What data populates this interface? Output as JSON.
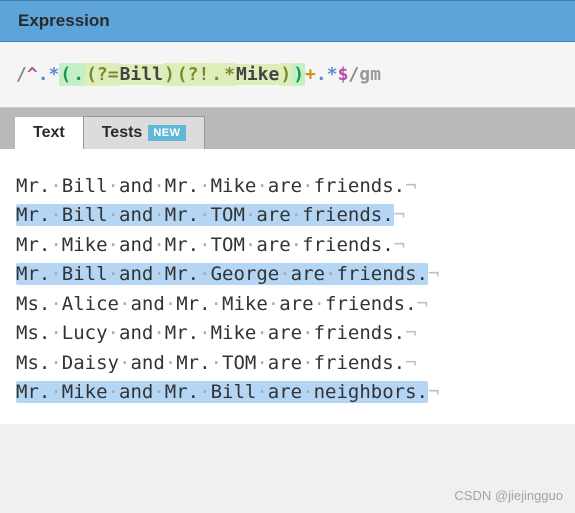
{
  "header": {
    "title": "Expression"
  },
  "regex": {
    "open_delim": "/",
    "anchor_start": "^",
    "dot1": ".",
    "star1": "*",
    "grp_open": "(",
    "dot2": ".",
    "look1_open": "(?=",
    "look1_text": "Bill",
    "look1_close": ")",
    "look2_open": "(?!",
    "look2_dot": ".",
    "look2_star": "*",
    "look2_text": "Mike",
    "look2_close": ")",
    "grp_close": ")",
    "plus": "+",
    "dot3": ".",
    "star3": "*",
    "anchor_end": "$",
    "close_delim": "/",
    "flags": "gm"
  },
  "tabs": {
    "text": "Text",
    "tests": "Tests",
    "badge": "NEW"
  },
  "lines": [
    {
      "w": [
        "Mr.",
        "Bill",
        "and",
        "Mr.",
        "Mike",
        "are",
        "friends."
      ],
      "match": false
    },
    {
      "w": [
        "Mr.",
        "Bill",
        "and",
        "Mr.",
        "TOM",
        "are",
        "friends."
      ],
      "match": true
    },
    {
      "w": [
        "Mr.",
        "Mike",
        "and",
        "Mr.",
        "TOM",
        "are",
        "friends."
      ],
      "match": false
    },
    {
      "w": [
        "Mr.",
        "Bill",
        "and",
        "Mr.",
        "George",
        "are",
        "friends."
      ],
      "match": true
    },
    {
      "w": [
        "Ms.",
        "Alice",
        "and",
        "Mr.",
        "Mike",
        "are",
        "friends."
      ],
      "match": false
    },
    {
      "w": [
        "Ms.",
        "Lucy",
        "and",
        "Mr.",
        "Mike",
        "are",
        "friends."
      ],
      "match": false
    },
    {
      "w": [
        "Ms.",
        "Daisy",
        "and",
        "Mr.",
        "TOM",
        "are",
        "friends."
      ],
      "match": false
    },
    {
      "w": [
        "Mr.",
        "Mike",
        "and",
        "Mr.",
        "Bill",
        "are",
        "neighbors."
      ],
      "match": true
    }
  ],
  "glyphs": {
    "space": "·",
    "return": "¬"
  },
  "watermark": "CSDN @jiejingguo"
}
